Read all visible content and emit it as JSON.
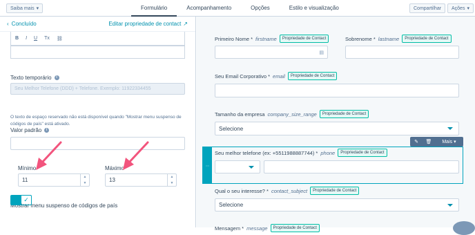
{
  "topbar": {
    "saiba_mais": "Saiba mais",
    "tabs": [
      "Formulário",
      "Acompanhamento",
      "Opções",
      "Estilo e visualização"
    ],
    "compartilhar": "Compartilhar",
    "acoes": "Ações"
  },
  "left": {
    "back": "Concluído",
    "edit_property": "Editar propriedade de contact",
    "rte": [
      "B",
      "I",
      "U",
      "Tx",
      "⛓"
    ],
    "placeholder_label": "Texto temporário",
    "placeholder_value": "Seu Melhor Telefone (DDD) + Telefone. Exemplo: 11922334455",
    "help": "O texto de espaço reservado não está disponível quando \"Mostrar menu suspenso de códigos de país\" está ativado.",
    "default_label": "Valor padrão",
    "min_label": "Mínimo",
    "min_value": "11",
    "max_label": "Máximo",
    "max_value": "13",
    "country_label": "Mostrar menu suspenso de códigos de país",
    "toggle_check": "✓"
  },
  "form": {
    "badge": "Propriedade de Contact",
    "first_name": {
      "label": "Primeiro Nome *",
      "internal": "firstname"
    },
    "last_name": {
      "label": "Sobrenome *",
      "internal": "lastname"
    },
    "email": {
      "label": "Seu Email Corporativo *",
      "internal": "email"
    },
    "company_size": {
      "label": "Tamanho da empresa",
      "internal": "company_size_range",
      "value": "Selecione"
    },
    "phone": {
      "label": "Seu melhor telefone (ex: +5511988887744) *",
      "internal": "phone"
    },
    "interest": {
      "label": "Qual o seu interesse? *",
      "internal": "contact_subject",
      "value": "Selecione"
    },
    "message": {
      "label": "Mensagem *",
      "internal": "message"
    },
    "float_mais": "Mais",
    "handle": "::::"
  },
  "colors": {
    "accent": "#00a4bd",
    "arrow": "#f2547d",
    "badge_border": "#00bda5"
  }
}
